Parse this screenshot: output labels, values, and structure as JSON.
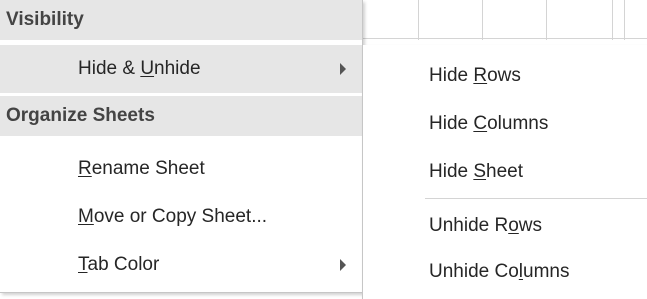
{
  "menu": {
    "visibility_header": "Visibility",
    "hide_unhide": {
      "before": "Hide & ",
      "accel": "U",
      "after": "nhide"
    },
    "organize_header": "Organize Sheets",
    "rename": {
      "accel": "R",
      "after": "ename Sheet"
    },
    "move_copy": {
      "accel": "M",
      "after": "ove or Copy Sheet..."
    },
    "tab_color": {
      "accel": "T",
      "after": "ab Color"
    }
  },
  "submenu": {
    "hide_rows": {
      "before": "Hide ",
      "accel": "R",
      "after": "ows"
    },
    "hide_columns": {
      "before": "Hide ",
      "accel": "C",
      "after": "olumns"
    },
    "hide_sheet": {
      "before": "Hide ",
      "accel": "S",
      "after": "heet"
    },
    "unhide_rows": {
      "before": "Unhide R",
      "accel": "o",
      "after": "ws"
    },
    "unhide_columns": {
      "before": "Unhide Co",
      "accel": "l",
      "after": "umns"
    }
  },
  "icons": {
    "submenu_arrow": "chevron-right-icon"
  },
  "colors": {
    "menu_bg": "#ffffff",
    "header_bg": "#e6e6e6",
    "hover_bg": "#e6e6e6",
    "text": "#262626",
    "border": "#c6c6c6"
  }
}
